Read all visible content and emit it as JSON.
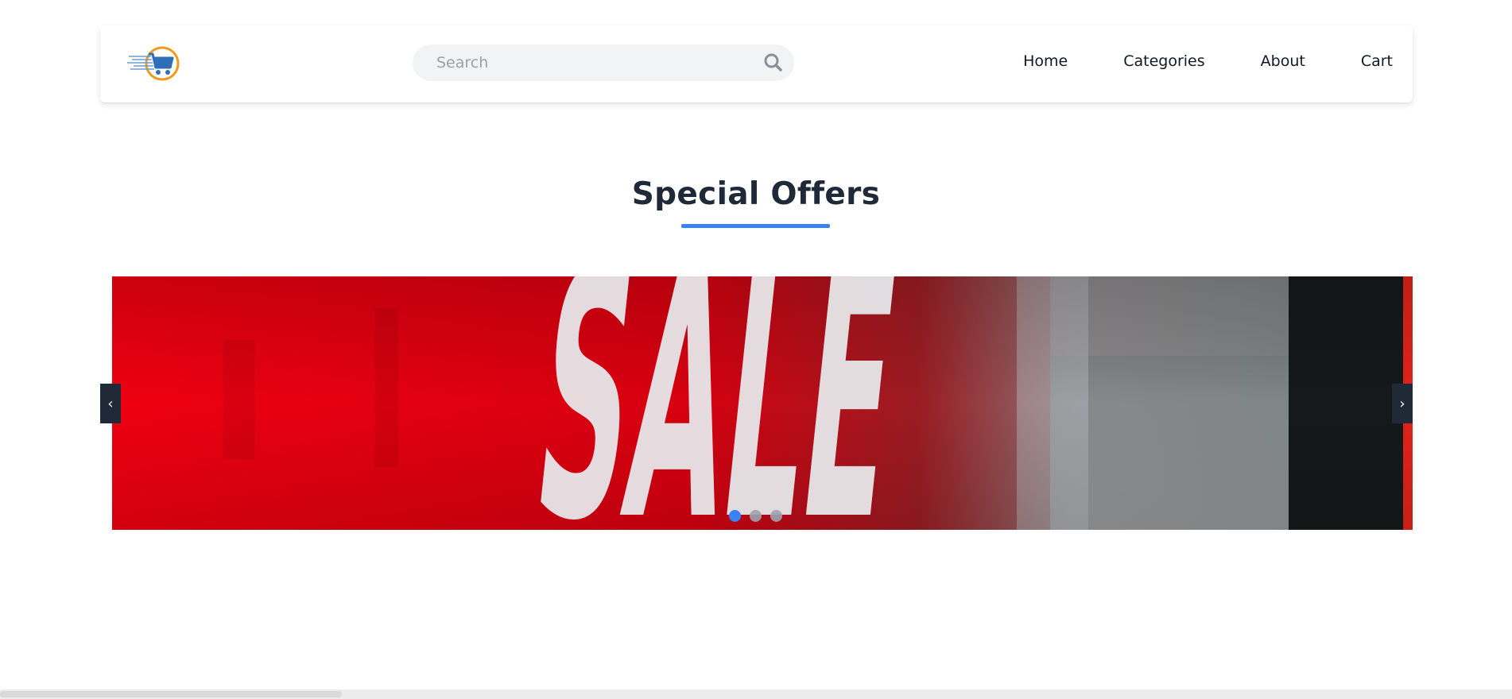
{
  "header": {
    "logo_icon": "shopping-cart-icon",
    "search": {
      "placeholder": "Search",
      "value": "",
      "icon": "search-icon"
    },
    "nav": [
      "Home",
      "Categories",
      "About",
      "Cart"
    ]
  },
  "offers": {
    "title": "Special Offers",
    "slide_text": "SALE",
    "prev_label": "‹",
    "next_label": "›",
    "slide_count": 3,
    "active_slide": 1
  },
  "colors": {
    "accent": "#3b82f6",
    "dark": "#1f2937",
    "logo_orange": "#f39a1e",
    "logo_blue": "#2f6fb7",
    "sale_red": "#e60012"
  }
}
